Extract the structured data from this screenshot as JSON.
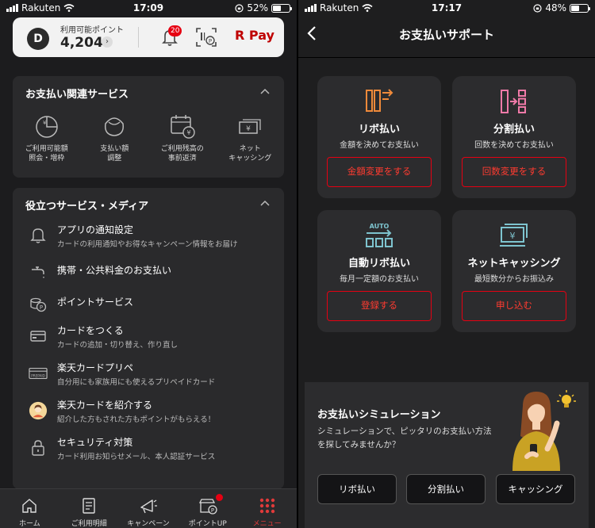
{
  "left_screen": {
    "status": {
      "carrier": "Rakuten",
      "time": "17:09",
      "battery": "52%",
      "battery_level": 0.52
    },
    "point_card": {
      "label": "利用可能ポイント",
      "value": "4,204",
      "coin_letter": "D",
      "bell_badge": "20",
      "rpay_label": "R Pay"
    },
    "payment_section": {
      "title": "お支払い関連サービス",
      "items": [
        {
          "label": "ご利用可能額\n照会・増枠",
          "icon": "pie-chart-yen-icon"
        },
        {
          "label": "支払い額\n調整",
          "icon": "wallet-icon"
        },
        {
          "label": "ご利用残高の\n事前返済",
          "icon": "calendar-yen-icon"
        },
        {
          "label": "ネット\nキャッシング",
          "icon": "yen-bills-icon"
        }
      ]
    },
    "media_section": {
      "title": "役立つサービス・メディア",
      "items": [
        {
          "title": "アプリの通知設定",
          "sub": "カードの利用通知やお得なキャンペーン情報をお届け",
          "icon": "bell-icon"
        },
        {
          "title": "携帯・公共料金のお支払い",
          "sub": "",
          "icon": "faucet-icon"
        },
        {
          "title": "ポイントサービス",
          "sub": "",
          "icon": "coins-icon"
        },
        {
          "title": "カードをつくる",
          "sub": "カードの追加・切り替え、作り直し",
          "icon": "card-icon"
        },
        {
          "title": "楽天カードプリペ",
          "sub": "自分用にも家族用にも使えるプリペイドカード",
          "icon": "prepaid-card-icon"
        },
        {
          "title": "楽天カードを紹介する",
          "sub": "紹介した方もされた方もポイントがもらえる！",
          "icon": "referral-avatar-icon"
        },
        {
          "title": "セキュリティ対策",
          "sub": "カード利用お知らせメール、本人認証サービス",
          "icon": "lock-icon"
        }
      ]
    },
    "tabbar": [
      {
        "label": "ホーム",
        "icon": "home-icon",
        "active": false
      },
      {
        "label": "ご利用明細",
        "icon": "statement-icon",
        "active": false
      },
      {
        "label": "キャンペーン",
        "icon": "megaphone-icon",
        "active": false
      },
      {
        "label": "ポイントUP",
        "icon": "shop-points-icon",
        "active": false
      },
      {
        "label": "メニュー",
        "icon": "grid-dots-icon",
        "active": true
      }
    ],
    "prepaid_icon_text": "PREPAID"
  },
  "right_screen": {
    "status": {
      "carrier": "Rakuten",
      "time": "17:17",
      "battery": "48%",
      "battery_level": 0.48
    },
    "nav_title": "お支払いサポート",
    "cards": [
      {
        "title": "リボ払い",
        "sub": "金額を決めてお支払い",
        "button": "金額変更をする",
        "icon": "revolving-icon"
      },
      {
        "title": "分割払い",
        "sub": "回数を決めてお支払い",
        "button": "回数変更をする",
        "icon": "installment-icon"
      },
      {
        "title": "自動リボ払い",
        "sub": "毎月一定額のお支払い",
        "button": "登録する",
        "icon": "auto-revolving-icon"
      },
      {
        "title": "ネットキャッシング",
        "sub": "最短数分からお振込み",
        "button": "申し込む",
        "icon": "cash-transfer-icon"
      }
    ],
    "auto_icon_text": "AUTO",
    "simulation": {
      "title": "お支払いシミュレーション",
      "desc": "シミュレーションで、ピッタリのお支払い方法を探してみませんか？",
      "buttons": [
        "リボ払い",
        "分割払い",
        "キャッシング"
      ]
    }
  },
  "colors": {
    "accent_red": "#e60012",
    "orange": "#ef8a3a",
    "pink": "#f07aa8",
    "teal": "#7ec4cf",
    "background": "#1c1c1e",
    "card": "#2c2c2e"
  }
}
